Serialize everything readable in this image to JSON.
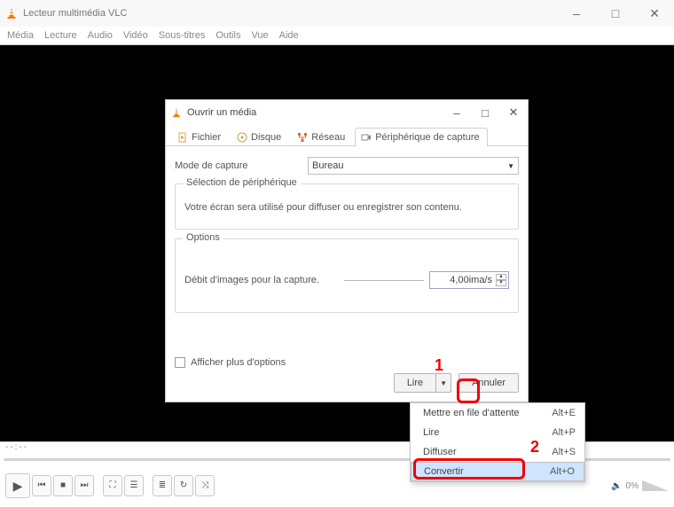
{
  "app": {
    "title": "Lecteur multimédia VLC"
  },
  "menubar": [
    "Média",
    "Lecture",
    "Audio",
    "Vidéo",
    "Sous-titres",
    "Outils",
    "Vue",
    "Aide"
  ],
  "controls": {
    "timecode": "--:--",
    "volume_pct": "0%"
  },
  "dialog": {
    "title": "Ouvrir un média",
    "tabs": {
      "file": "Fichier",
      "disc": "Disque",
      "network": "Réseau",
      "capture": "Périphérique de capture"
    },
    "mode_label": "Mode de capture",
    "mode_value": "Bureau",
    "group1": {
      "legend": "Sélection de périphérique",
      "text": "Votre écran sera utilisé pour diffuser ou enregistrer son contenu."
    },
    "group2": {
      "legend": "Options",
      "rate_label": "Débit d'images pour la capture.",
      "rate_value": "4,00ima/s"
    },
    "show_more": "Afficher plus d'options",
    "play": "Lire",
    "cancel": "Annuler"
  },
  "menu": {
    "items": [
      {
        "label": "Mettre en file d'attente",
        "shortcut": "Alt+E"
      },
      {
        "label": "Lire",
        "shortcut": "Alt+P"
      },
      {
        "label": "Diffuser",
        "shortcut": "Alt+S"
      },
      {
        "label": "Convertir",
        "shortcut": "Alt+O"
      }
    ]
  },
  "annotations": {
    "n1": "1",
    "n2": "2"
  }
}
